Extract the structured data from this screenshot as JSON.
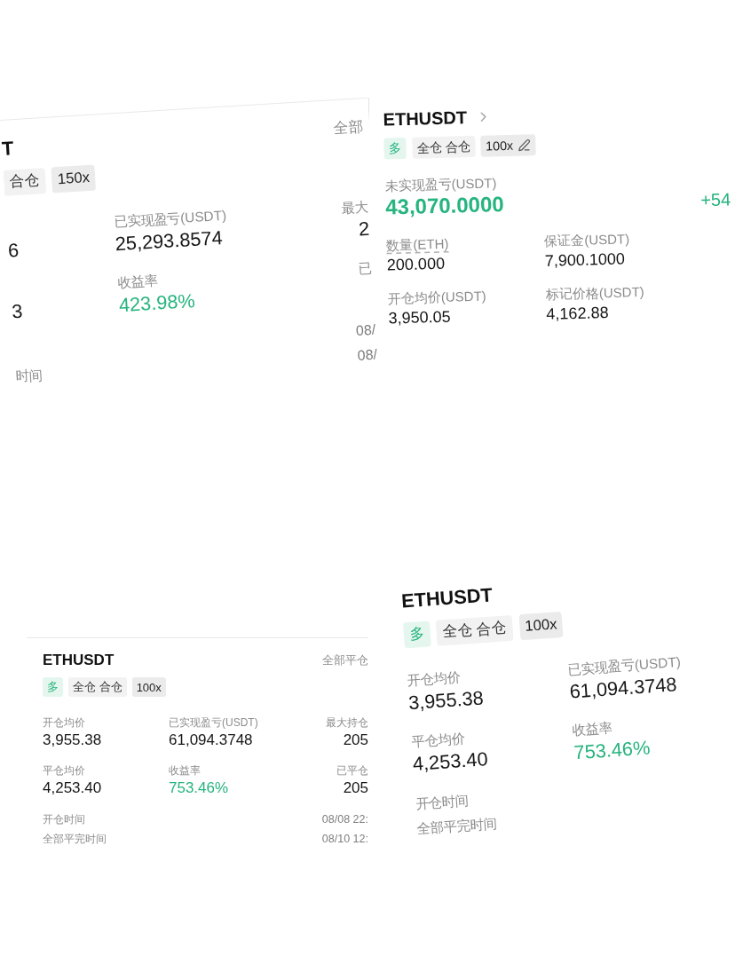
{
  "card_top_left": {
    "symbol": "T",
    "action": "全部",
    "tags": [
      {
        "kind": "margin",
        "text": "合仓",
        "editable": false
      },
      {
        "kind": "leverage",
        "text": "150x",
        "editable": false
      }
    ],
    "fields": [
      {
        "value": "6",
        "kind": "plain"
      },
      {
        "label": "已实现盈亏(USDT)",
        "value": "25,293.8574",
        "kind": "plain"
      },
      {
        "label": "最大",
        "value": "2",
        "kind": "plain"
      },
      {
        "value": "3",
        "kind": "plain"
      },
      {
        "label": "收益率",
        "value": "423.98%",
        "kind": "gain"
      },
      {
        "label": "已"
      }
    ],
    "times": [
      {
        "value": "08/"
      },
      {
        "label": "时间",
        "value": "08/"
      }
    ]
  },
  "card_top_right": {
    "symbol": "ETHUSDT",
    "tags": [
      {
        "kind": "side",
        "text": "多",
        "editable": false
      },
      {
        "kind": "margin",
        "text": "全仓 合仓",
        "editable": false
      },
      {
        "kind": "leverage",
        "text": "100x",
        "editable": true
      }
    ],
    "headline": {
      "label": "未实现盈亏(USDT)",
      "value": "43,070.0000",
      "kind": "gain"
    },
    "change": {
      "text": "+54",
      "kind": "gain"
    },
    "fields": [
      {
        "label": "数量(ETH)",
        "value": "200.000",
        "underlined": true
      },
      {
        "label": "保证金(USDT)",
        "value": "7,900.1000",
        "underlined": false
      },
      {
        "label": "开仓均价(USDT)",
        "value": "3,950.05",
        "underlined": false
      },
      {
        "label": "标记价格(USDT)",
        "value": "4,162.88",
        "underlined": false
      }
    ]
  },
  "card_bottom_left": {
    "symbol": "ETHUSDT",
    "action": "全部平仓",
    "tags": [
      {
        "kind": "side",
        "text": "多",
        "editable": false
      },
      {
        "kind": "margin",
        "text": "全仓 合仓",
        "editable": false
      },
      {
        "kind": "leverage",
        "text": "100x",
        "editable": false
      }
    ],
    "fields": [
      {
        "label": "开仓均价",
        "value": "3,955.38",
        "kind": "plain"
      },
      {
        "label": "已实现盈亏(USDT)",
        "value": "61,094.3748",
        "kind": "plain"
      },
      {
        "label": "最大持仓",
        "value": "205",
        "kind": "plain"
      },
      {
        "label": "平仓均价",
        "value": "4,253.40",
        "kind": "plain"
      },
      {
        "label": "收益率",
        "value": "753.46%",
        "kind": "gain"
      },
      {
        "label": "已平仓",
        "value": "205",
        "kind": "plain"
      }
    ],
    "times": [
      {
        "label": "开仓时间",
        "value": "08/08 22:"
      },
      {
        "label": "全部平完时间",
        "value": "08/10 12:"
      }
    ]
  },
  "card_bottom_right": {
    "symbol": "ETHUSDT",
    "tags": [
      {
        "kind": "side",
        "text": "多",
        "editable": false
      },
      {
        "kind": "margin",
        "text": "全仓 合仓",
        "editable": false
      },
      {
        "kind": "leverage",
        "text": "100x",
        "editable": false
      }
    ],
    "fields": [
      {
        "label": "开仓均价",
        "value": "3,955.38",
        "kind": "plain"
      },
      {
        "label": "已实现盈亏(USDT)",
        "value": "61,094.3748",
        "kind": "plain"
      },
      {
        "label": "平仓均价",
        "value": "4,253.40",
        "kind": "plain"
      },
      {
        "label": "收益率",
        "value": "753.46%",
        "kind": "gain"
      }
    ],
    "times": [
      {
        "label": "开仓时间"
      },
      {
        "label": "全部平完时间"
      }
    ]
  }
}
